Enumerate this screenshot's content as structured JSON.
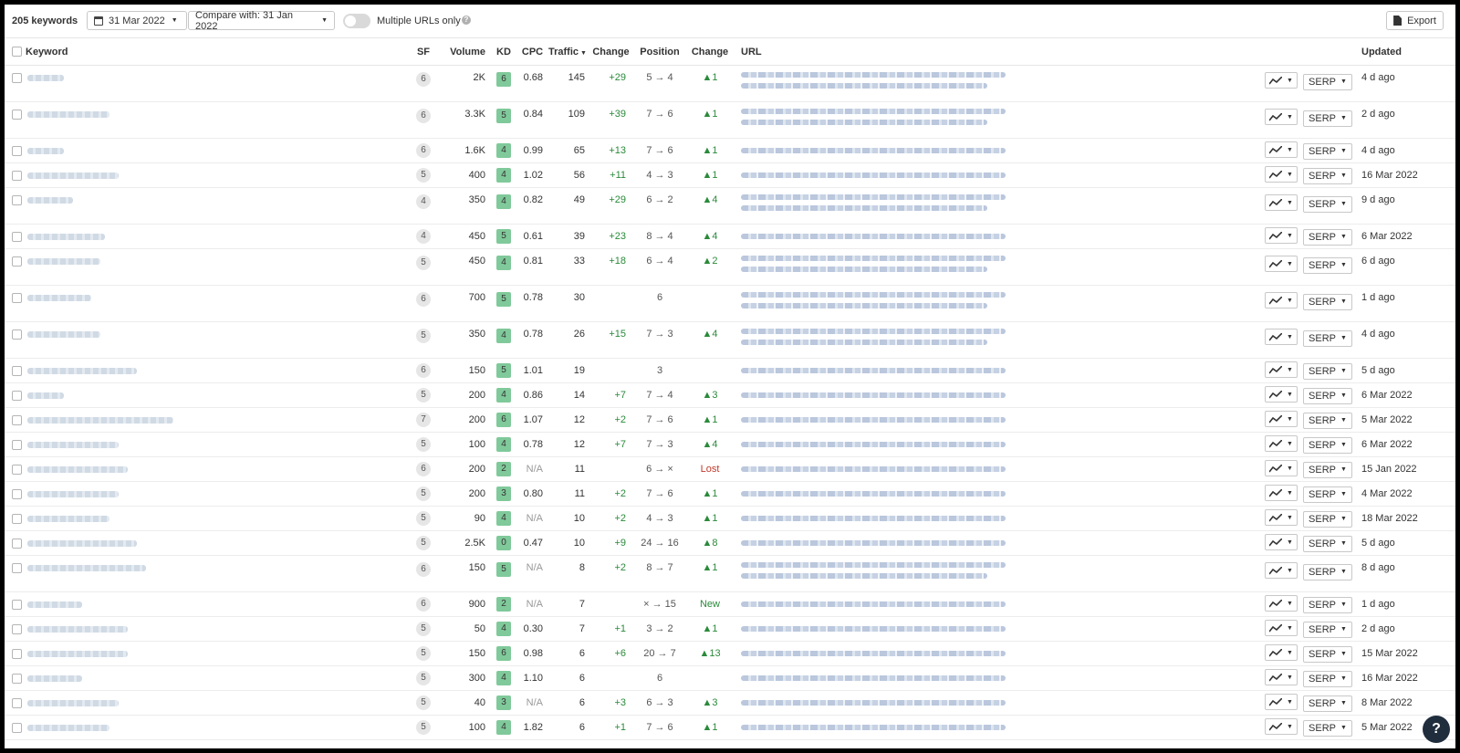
{
  "toolbar": {
    "keyword_count": "205 keywords",
    "date_label": "31 Mar 2022",
    "compare_label": "Compare with: 31 Jan 2022",
    "multiple_urls_label": "Multiple URLs only",
    "multiple_urls_on": false,
    "info_glyph": "?",
    "export_label": "Export"
  },
  "columns": {
    "keyword": "Keyword",
    "sf": "SF",
    "volume": "Volume",
    "kd": "KD",
    "cpc": "CPC",
    "traffic": "Traffic",
    "traffic_sort_icon": "sort-desc-icon",
    "traffic_change": "Change",
    "position": "Position",
    "position_change": "Change",
    "url": "URL",
    "updated": "Updated"
  },
  "row_buttons": {
    "serp_label": "SERP"
  },
  "colors": {
    "kd_badge": "#80c99a",
    "positive": "#2a8a3a",
    "lost": "#c0392b"
  },
  "help": {
    "label": "?"
  },
  "rows": [
    {
      "sf": "6",
      "volume": "2K",
      "kd": "6",
      "cpc": "0.68",
      "traffic": "145",
      "traffic_change": "+29",
      "position": "5 → 4",
      "position_change": "▲1",
      "updated": "4 d ago",
      "tall": true,
      "change_type": "up"
    },
    {
      "sf": "6",
      "volume": "3.3K",
      "kd": "5",
      "cpc": "0.84",
      "traffic": "109",
      "traffic_change": "+39",
      "position": "7 → 6",
      "position_change": "▲1",
      "updated": "2 d ago",
      "tall": true,
      "change_type": "up"
    },
    {
      "sf": "6",
      "volume": "1.6K",
      "kd": "4",
      "cpc": "0.99",
      "traffic": "65",
      "traffic_change": "+13",
      "position": "7 → 6",
      "position_change": "▲1",
      "updated": "4 d ago",
      "tall": false,
      "change_type": "up"
    },
    {
      "sf": "5",
      "volume": "400",
      "kd": "4",
      "cpc": "1.02",
      "traffic": "56",
      "traffic_change": "+11",
      "position": "4 → 3",
      "position_change": "▲1",
      "updated": "16 Mar 2022",
      "tall": false,
      "change_type": "up"
    },
    {
      "sf": "4",
      "volume": "350",
      "kd": "4",
      "cpc": "0.82",
      "traffic": "49",
      "traffic_change": "+29",
      "position": "6 → 2",
      "position_change": "▲4",
      "updated": "9 d ago",
      "tall": true,
      "change_type": "up"
    },
    {
      "sf": "4",
      "volume": "450",
      "kd": "5",
      "cpc": "0.61",
      "traffic": "39",
      "traffic_change": "+23",
      "position": "8 → 4",
      "position_change": "▲4",
      "updated": "6 Mar 2022",
      "tall": false,
      "change_type": "up"
    },
    {
      "sf": "5",
      "volume": "450",
      "kd": "4",
      "cpc": "0.81",
      "traffic": "33",
      "traffic_change": "+18",
      "position": "6 → 4",
      "position_change": "▲2",
      "updated": "6 d ago",
      "tall": true,
      "change_type": "up"
    },
    {
      "sf": "6",
      "volume": "700",
      "kd": "5",
      "cpc": "0.78",
      "traffic": "30",
      "traffic_change": "",
      "position": "6",
      "position_change": "",
      "updated": "1 d ago",
      "tall": true,
      "change_type": ""
    },
    {
      "sf": "5",
      "volume": "350",
      "kd": "4",
      "cpc": "0.78",
      "traffic": "26",
      "traffic_change": "+15",
      "position": "7 → 3",
      "position_change": "▲4",
      "updated": "4 d ago",
      "tall": true,
      "change_type": "up"
    },
    {
      "sf": "6",
      "volume": "150",
      "kd": "5",
      "cpc": "1.01",
      "traffic": "19",
      "traffic_change": "",
      "position": "3",
      "position_change": "",
      "updated": "5 d ago",
      "tall": false,
      "change_type": ""
    },
    {
      "sf": "5",
      "volume": "200",
      "kd": "4",
      "cpc": "0.86",
      "traffic": "14",
      "traffic_change": "+7",
      "position": "7 → 4",
      "position_change": "▲3",
      "updated": "6 Mar 2022",
      "tall": false,
      "change_type": "up"
    },
    {
      "sf": "7",
      "volume": "200",
      "kd": "6",
      "cpc": "1.07",
      "traffic": "12",
      "traffic_change": "+2",
      "position": "7 → 6",
      "position_change": "▲1",
      "updated": "5 Mar 2022",
      "tall": false,
      "change_type": "up"
    },
    {
      "sf": "5",
      "volume": "100",
      "kd": "4",
      "cpc": "0.78",
      "traffic": "12",
      "traffic_change": "+7",
      "position": "7 → 3",
      "position_change": "▲4",
      "updated": "6 Mar 2022",
      "tall": false,
      "change_type": "up"
    },
    {
      "sf": "6",
      "volume": "200",
      "kd": "2",
      "cpc": "N/A",
      "traffic": "11",
      "traffic_change": "",
      "position": "6 → ×",
      "position_change": "Lost",
      "updated": "15 Jan 2022",
      "tall": false,
      "change_type": "lost"
    },
    {
      "sf": "5",
      "volume": "200",
      "kd": "3",
      "cpc": "0.80",
      "traffic": "11",
      "traffic_change": "+2",
      "position": "7 → 6",
      "position_change": "▲1",
      "updated": "4 Mar 2022",
      "tall": false,
      "change_type": "up"
    },
    {
      "sf": "5",
      "volume": "90",
      "kd": "4",
      "cpc": "N/A",
      "traffic": "10",
      "traffic_change": "+2",
      "position": "4 → 3",
      "position_change": "▲1",
      "updated": "18 Mar 2022",
      "tall": false,
      "change_type": "up"
    },
    {
      "sf": "5",
      "volume": "2.5K",
      "kd": "0",
      "cpc": "0.47",
      "traffic": "10",
      "traffic_change": "+9",
      "position": "24 → 16",
      "position_change": "▲8",
      "updated": "5 d ago",
      "tall": false,
      "change_type": "up"
    },
    {
      "sf": "6",
      "volume": "150",
      "kd": "5",
      "cpc": "N/A",
      "traffic": "8",
      "traffic_change": "+2",
      "position": "8 → 7",
      "position_change": "▲1",
      "updated": "8 d ago",
      "tall": true,
      "change_type": "up"
    },
    {
      "sf": "6",
      "volume": "900",
      "kd": "2",
      "cpc": "N/A",
      "traffic": "7",
      "traffic_change": "",
      "position": "× → 15",
      "position_change": "New",
      "updated": "1 d ago",
      "tall": false,
      "change_type": "new"
    },
    {
      "sf": "5",
      "volume": "50",
      "kd": "4",
      "cpc": "0.30",
      "traffic": "7",
      "traffic_change": "+1",
      "position": "3 → 2",
      "position_change": "▲1",
      "updated": "2 d ago",
      "tall": false,
      "change_type": "up"
    },
    {
      "sf": "5",
      "volume": "150",
      "kd": "6",
      "cpc": "0.98",
      "traffic": "6",
      "traffic_change": "+6",
      "position": "20 → 7",
      "position_change": "▲13",
      "updated": "15 Mar 2022",
      "tall": false,
      "change_type": "up"
    },
    {
      "sf": "5",
      "volume": "300",
      "kd": "4",
      "cpc": "1.10",
      "traffic": "6",
      "traffic_change": "",
      "position": "6",
      "position_change": "",
      "updated": "16 Mar 2022",
      "tall": false,
      "change_type": ""
    },
    {
      "sf": "5",
      "volume": "40",
      "kd": "3",
      "cpc": "N/A",
      "traffic": "6",
      "traffic_change": "+3",
      "position": "6 → 3",
      "position_change": "▲3",
      "updated": "8 Mar 2022",
      "tall": false,
      "change_type": "up"
    },
    {
      "sf": "5",
      "volume": "100",
      "kd": "4",
      "cpc": "1.82",
      "traffic": "6",
      "traffic_change": "+1",
      "position": "7 → 6",
      "position_change": "▲1",
      "updated": "5 Mar 2022",
      "tall": false,
      "change_type": "up"
    }
  ]
}
